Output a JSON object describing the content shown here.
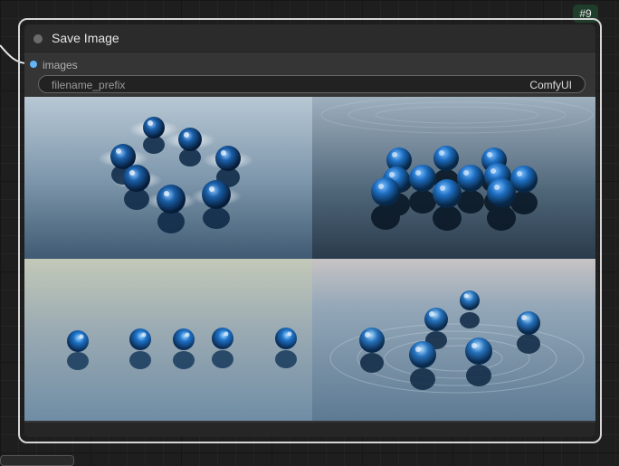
{
  "node": {
    "id_badge": "#9",
    "title": "Save Image",
    "input": {
      "label": "images"
    },
    "widget": {
      "label": "filename_prefix",
      "value": "ComfyUI"
    }
  },
  "colors": {
    "canvas": "#1e1e1e",
    "node_border": "#d6d6d6",
    "node_body": "#353535",
    "input_dot": "#64b5f6",
    "badge_bg": "#1e3d2a"
  },
  "images": [
    {
      "name": "blue-spheres-ring"
    },
    {
      "name": "blue-spheres-cluster"
    },
    {
      "name": "blue-spheres-row"
    },
    {
      "name": "blue-spheres-ripples"
    }
  ]
}
